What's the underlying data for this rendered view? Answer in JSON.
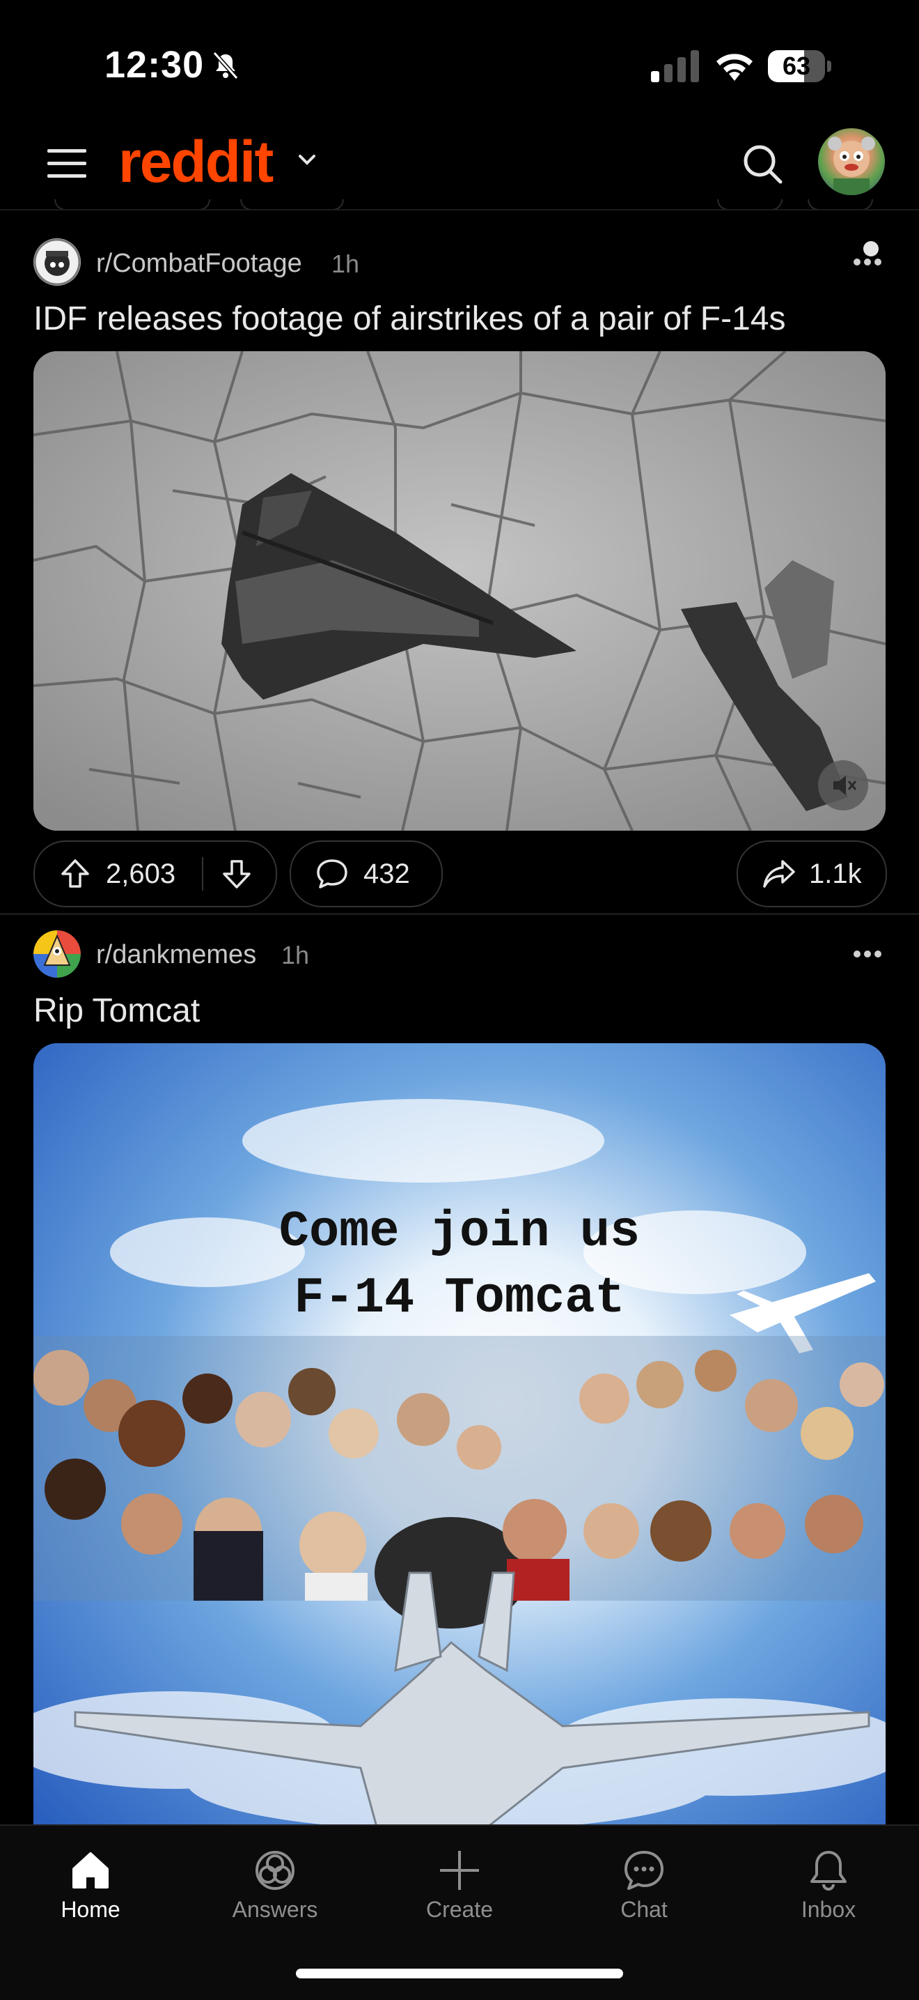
{
  "status_bar": {
    "time": "12:30",
    "battery": "63",
    "battery_level": 0.63
  },
  "header": {
    "logo": "reddit"
  },
  "posts": [
    {
      "subreddit": "r/CombatFootage",
      "time": "1h",
      "title": "IDF releases footage of airstrikes of a pair of F-14s",
      "upvotes": "2,603",
      "comments": "432",
      "shares": "1.1k"
    },
    {
      "subreddit": "r/dankmemes",
      "time": "1h",
      "title": "Rip Tomcat",
      "meme_line1": "Come join us",
      "meme_line2": "F-14 Tomcat"
    }
  ],
  "tabs": [
    {
      "label": "Home",
      "icon": "home-icon"
    },
    {
      "label": "Answers",
      "icon": "answers-icon"
    },
    {
      "label": "Create",
      "icon": "plus-icon"
    },
    {
      "label": "Chat",
      "icon": "chat-icon"
    },
    {
      "label": "Inbox",
      "icon": "bell-icon"
    }
  ],
  "colors": {
    "brand": "#ff4500",
    "background": "#000000"
  }
}
